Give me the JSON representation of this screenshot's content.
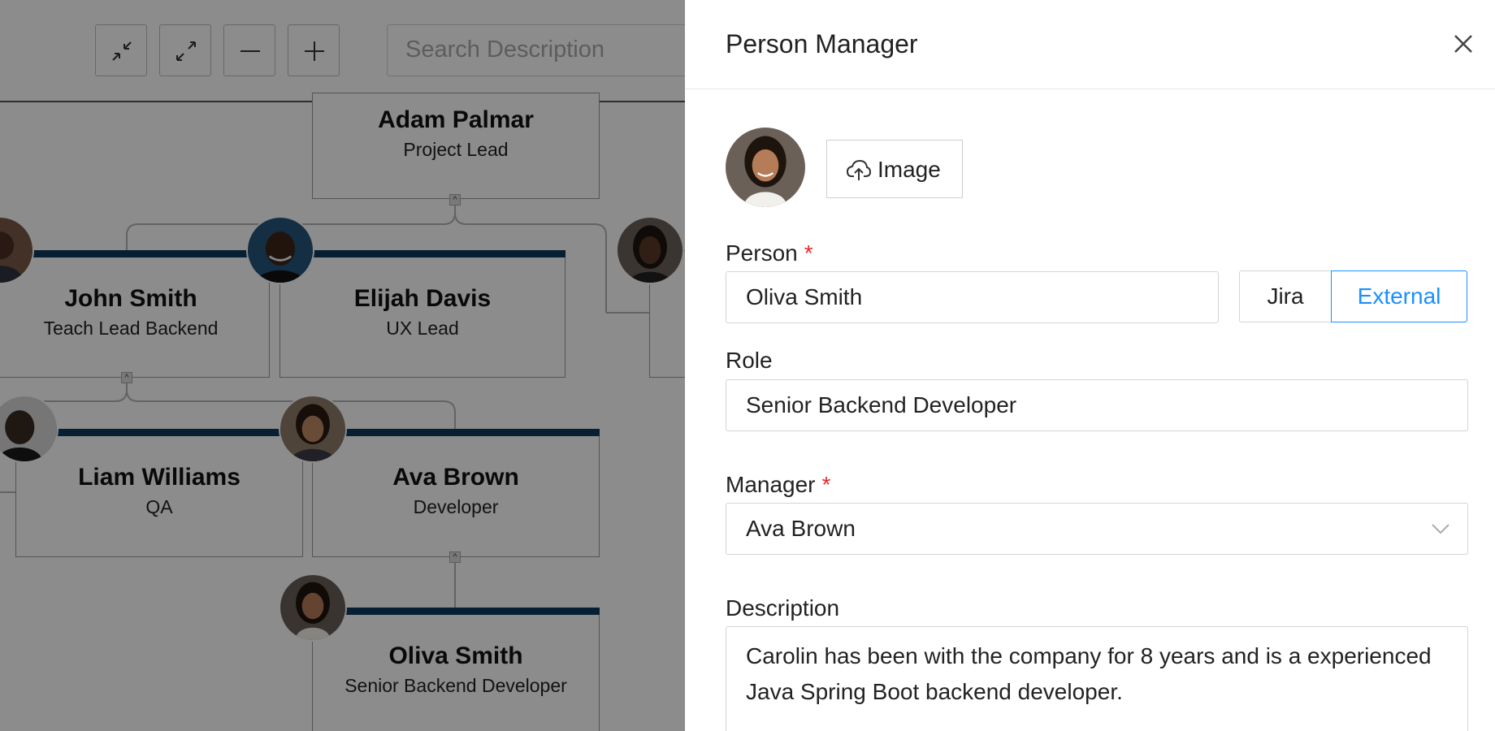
{
  "toolbar": {
    "collapse_icon": "collapse-arrows-icon",
    "expand_icon": "expand-arrows-icon",
    "zoom_out_icon": "minus-icon",
    "zoom_in_icon": "plus-icon",
    "search_placeholder": "Search Description"
  },
  "chart": {
    "nodes": [
      {
        "name": "Adam Palmar",
        "role": "Project Lead"
      },
      {
        "name": "John Smith",
        "role": "Teach Lead Backend"
      },
      {
        "name": "Elijah Davis",
        "role": "UX Lead"
      },
      {
        "name": "Liam Williams",
        "role": "QA"
      },
      {
        "name": "Ava Brown",
        "role": "Developer"
      },
      {
        "name": "Oliva Smith",
        "role": "Senior Backend Developer"
      }
    ]
  },
  "drawer": {
    "title": "Person Manager",
    "close_icon": "close-icon",
    "upload_label": "Image",
    "upload_icon": "cloud-upload-icon",
    "person_label": "Person",
    "person_value": "Oliva Smith",
    "source_options": [
      "Jira",
      "External"
    ],
    "source_selected": "External",
    "role_label": "Role",
    "role_value": "Senior Backend Developer",
    "manager_label": "Manager",
    "manager_value": "Ava Brown",
    "description_label": "Description",
    "description_value": "Carolin has been with the company for 8 years and is a experienced Java Spring Boot backend developer.",
    "required_marker": "*"
  },
  "colors": {
    "accent": "#1890ff",
    "required": "#e8272d",
    "node_bar": "#0b3a5c"
  }
}
